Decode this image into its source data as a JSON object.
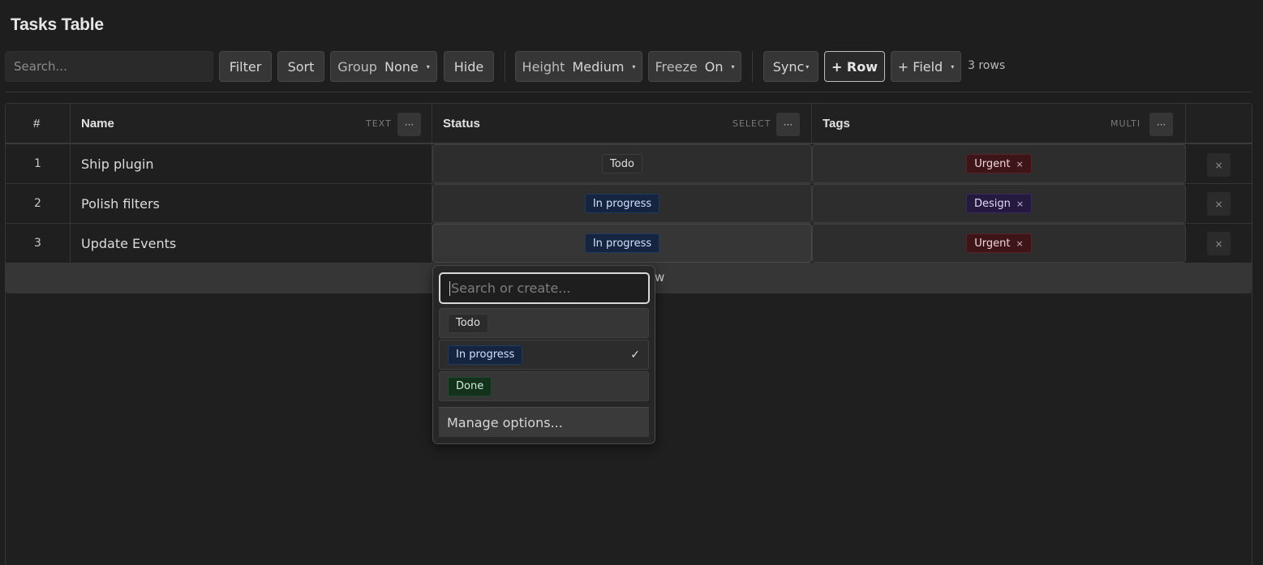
{
  "title": "Tasks Table",
  "toolbar": {
    "search_placeholder": "Search...",
    "filter": "Filter",
    "sort": "Sort",
    "group_label": "Group",
    "group_value": "None",
    "hide": "Hide",
    "height_label": "Height",
    "height_value": "Medium",
    "freeze_label": "Freeze",
    "freeze_value": "On",
    "sync": "Sync",
    "add_row": "+ Row",
    "add_field": "+ Field",
    "row_count": "3 rows"
  },
  "columns": [
    {
      "label": "#"
    },
    {
      "label": "Name",
      "type": "TEXT"
    },
    {
      "label": "Status",
      "type": "SELECT"
    },
    {
      "label": "Tags",
      "type": "MULTI"
    }
  ],
  "more_glyph": "···",
  "rows": [
    {
      "num": "1",
      "name": "Ship plugin",
      "status": "Todo",
      "tag": "Urgent"
    },
    {
      "num": "2",
      "name": "Polish filters",
      "status": "In progress",
      "tag": "Design"
    },
    {
      "num": "3",
      "name": "Update Events",
      "status": "In progress",
      "tag": "Urgent"
    }
  ],
  "remove_glyph": "×",
  "add_row_label": "w",
  "dropdown": {
    "placeholder": "Search or create...",
    "options": [
      {
        "label": "Todo",
        "selected": false
      },
      {
        "label": "In progress",
        "selected": true
      },
      {
        "label": "Done",
        "selected": false
      }
    ],
    "check_glyph": "✓",
    "manage": "Manage options..."
  },
  "colors": {
    "todo_bg": "#2b2b2b",
    "in_progress_bg": "#152540",
    "done_bg": "#13321c",
    "urgent_bg": "#3d1518",
    "design_bg": "#25193f"
  }
}
